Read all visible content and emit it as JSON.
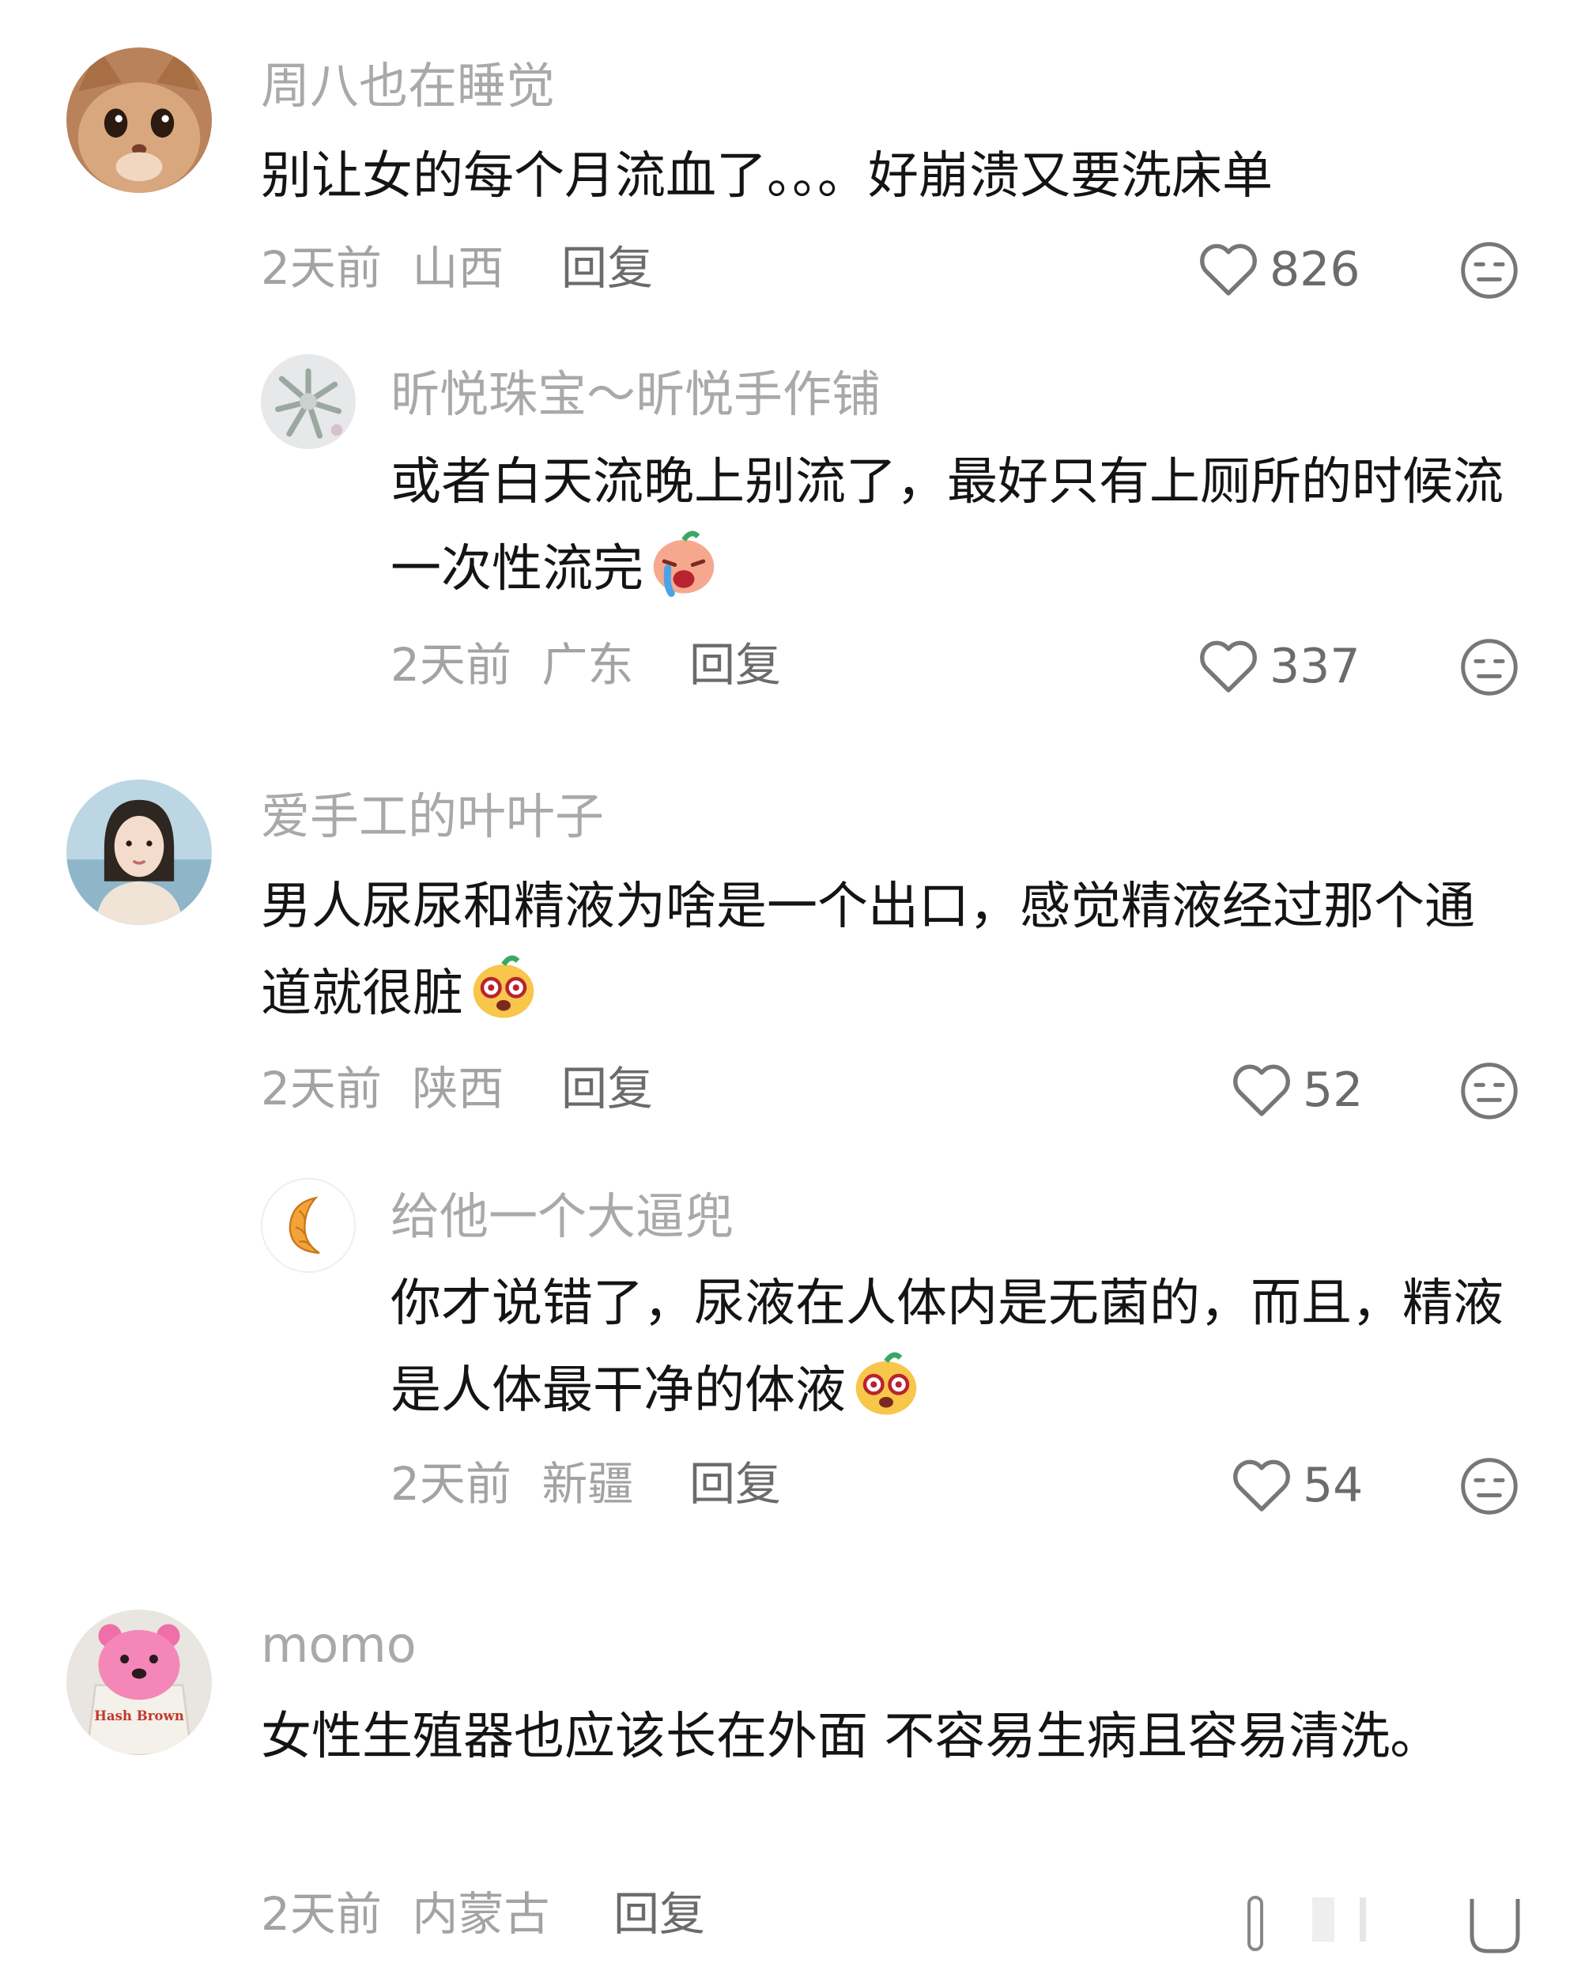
{
  "comments": [
    {
      "username": "周八也在睡觉",
      "text": "别让女的每个月流血了。。。好崩溃又要洗床单",
      "time": "2天前",
      "location": "山西",
      "reply_label": "回复",
      "likes": "826",
      "avatar_icon": "cat-avatar"
    },
    {
      "username": "昕悦珠宝～昕悦手作铺",
      "text": "或者白天流晚上别流了，最好只有上厕所的时候流一次性流完",
      "time": "2天前",
      "location": "广东",
      "reply_label": "回复",
      "likes": "337",
      "avatar_icon": "flower-avatar",
      "emoji": "crying-face-emoji"
    },
    {
      "username": "爱手工的叶叶子",
      "text": "男人尿尿和精液为啥是一个出口，感觉精液经过那个通道就很脏",
      "time": "2天前",
      "location": "陕西",
      "reply_label": "回复",
      "likes": "52",
      "avatar_icon": "girl-avatar",
      "emoji": "dizzy-face-emoji"
    },
    {
      "username": "给他一个大逼兜",
      "text": "你才说错了，尿液在人体内是无菌的，而且，精液是人体最干净的体液",
      "time": "2天前",
      "location": "新疆",
      "reply_label": "回复",
      "likes": "54",
      "avatar_icon": "croissant-avatar",
      "emoji": "dizzy-face-emoji"
    },
    {
      "username": "momo",
      "text": "女性生殖器也应该长在外面 不容易生病且容易清洗。",
      "time": "2天前",
      "location": "内蒙古",
      "reply_label": "回复",
      "avatar_icon": "pink-bear-avatar",
      "avatar_text": "Hash Brown"
    }
  ],
  "colors": {
    "username": "#a9a9a9",
    "text": "#141414",
    "meta": "#a3a3a3",
    "reply": "#6b6b6b",
    "icon": "#777777"
  }
}
